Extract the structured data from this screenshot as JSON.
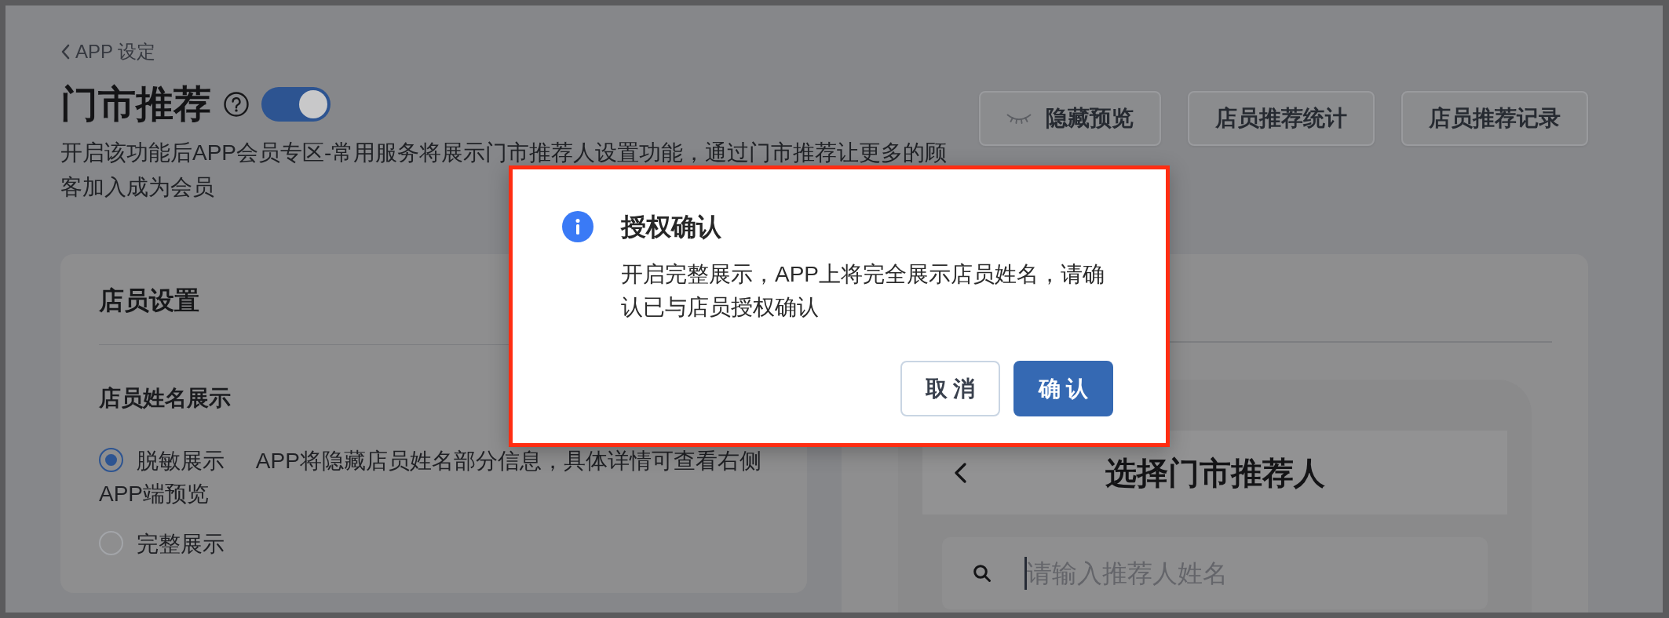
{
  "back_link": {
    "label": "APP 设定"
  },
  "header": {
    "title": "门市推荐",
    "toggle": {
      "on": true
    },
    "description": "开启该功能后APP会员专区-常用服务将展示门市推荐人设置功能，通过门市推荐让更多的顾客加入成为会员"
  },
  "actions": [
    {
      "label": "隐藏预览",
      "kind": "icon"
    },
    {
      "label": "店员推荐统计",
      "kind": "text"
    },
    {
      "label": "店员推荐记录",
      "kind": "text"
    }
  ],
  "staff_settings": {
    "title": "店员设置",
    "name_display": {
      "label": "店员姓名展示",
      "options": [
        {
          "label": "脱敏展示",
          "hint": "APP将隐藏店员姓名部分信息，具体详情可查看右侧APP端预览",
          "selected": true
        },
        {
          "label": "完整展示",
          "selected": false
        }
      ]
    }
  },
  "app_preview": {
    "screen_title": "选择门市推荐人",
    "search": {
      "placeholder": "请输入推荐人姓名",
      "focused": true
    }
  },
  "dialog": {
    "title": "授权确认",
    "message": "开启完整展示，APP上将完全展示店员姓名，请确认已与店员授权确认",
    "buttons": [
      {
        "label": "取 消",
        "kind": "secondary"
      },
      {
        "label": "确 认",
        "kind": "primary"
      }
    ]
  }
}
